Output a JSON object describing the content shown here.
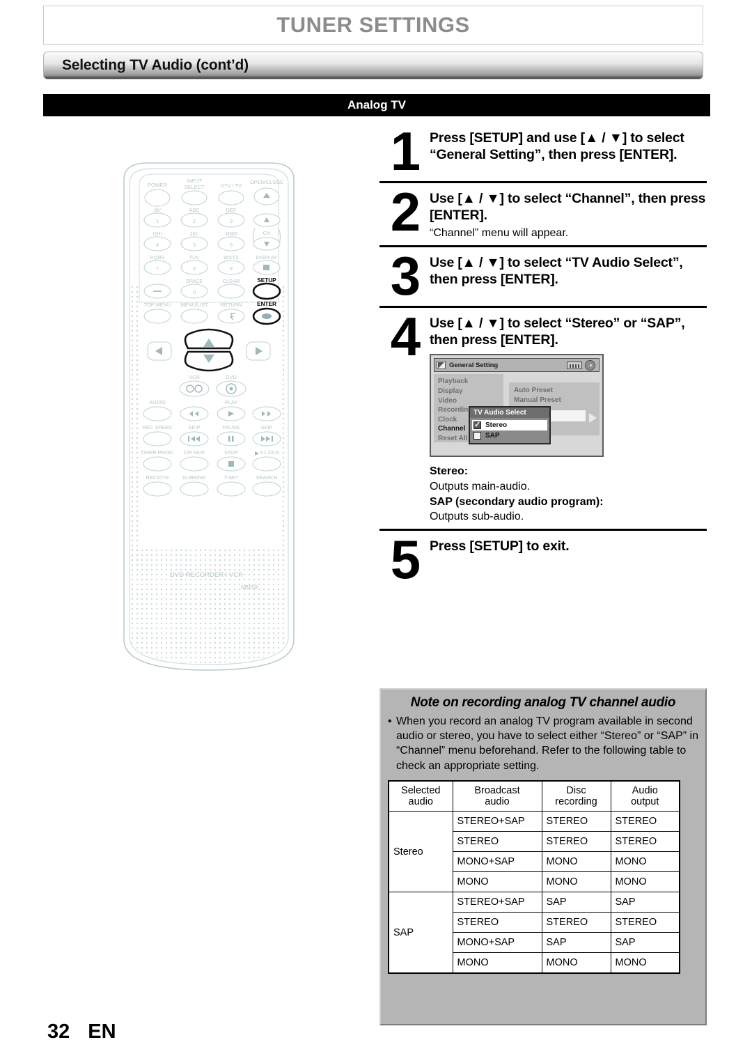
{
  "header": {
    "chapter_title": "TUNER SETTINGS",
    "section_title": "Selecting TV Audio (cont’d)",
    "subhead": "Analog TV"
  },
  "remote": {
    "brand": "DVD RECORDER / VCR",
    "model": "NB659",
    "buttons": [
      "POWER",
      "INPUT SELECT",
      "DTV / TV",
      "OPEN/CLOSE",
      ".@/:",
      "ABC",
      "DEF",
      "GHI",
      "JKL",
      "MNO",
      "CH",
      "PQRS",
      "TUV",
      "WXYZ",
      "DISPLAY",
      "SPACE",
      "CLEAR",
      "SETUP",
      "TOP MENU",
      "MENU/LIST",
      "RETURN",
      "ENTER",
      "VCR",
      "DVD",
      "AUDIO",
      "PLAY",
      "REC SPEED",
      "SKIP",
      "PAUSE",
      "SKIP",
      "TIMER PROG.",
      "CM SKIP",
      "STOP",
      "X1.3/0.8",
      "REC/OTR",
      "DUBBING",
      "T-SET",
      "SEARCH"
    ],
    "labels": {
      "power": "POWER",
      "input_select_l1": "INPUT",
      "input_select_l2": "SELECT",
      "dtv_tv": "DTV / TV",
      "open_close": "OPEN/CLOSE",
      "k1": ".@/:",
      "k2": "ABC",
      "k3": "DEF",
      "k4": "GHI",
      "k5": "JKL",
      "k6": "MNO",
      "k7": "PQRS",
      "k8": "TUV",
      "k9": "WXYZ",
      "ch": "CH",
      "display": "DISPLAY",
      "space": "SPACE",
      "clear": "CLEAR",
      "setup": "SETUP",
      "top_menu": "TOP MENU",
      "menu_list": "MENU/LIST",
      "return": "RETURN",
      "enter": "ENTER",
      "vcr": "VCR",
      "dvd": "DVD",
      "audio": "AUDIO",
      "play": "PLAY",
      "rec_speed": "REC SPEED",
      "skip_back": "SKIP",
      "pause": "PAUSE",
      "skip_fwd": "SKIP",
      "timer_prog": "TIMER PROG.",
      "cm_skip": "CM SKIP",
      "stop": "STOP",
      "speed": "X1.3/0.8",
      "rec_otr": "REC/OTR",
      "dubbing": "DUBBING",
      "t_set": "T-SET",
      "search": "SEARCH",
      "num1": "1",
      "num2": "2",
      "num3": "3",
      "num4": "4",
      "num5": "5",
      "num6": "6",
      "num7": "7",
      "num8": "8",
      "num9": "9",
      "num0": "0"
    }
  },
  "steps": [
    {
      "num": "1",
      "main": "Press [SETUP] and use [▲ / ▼] to select “General Setting”, then press [ENTER].",
      "sub": ""
    },
    {
      "num": "2",
      "main": "Use [▲ / ▼] to select “Channel”, then press [ENTER].",
      "sub": "“Channel” menu will appear."
    },
    {
      "num": "3",
      "main": "Use [▲ / ▼] to select “TV Audio Select”, then press [ENTER].",
      "sub": ""
    },
    {
      "num": "4",
      "main": "Use [▲ / ▼] to select “Stereo” or “SAP”, then press [ENTER].",
      "sub": ""
    },
    {
      "num": "5",
      "main": "Press [SETUP] to exit.",
      "sub": ""
    }
  ],
  "osd": {
    "title": "General Setting",
    "menu_items": [
      "Playback",
      "Display",
      "Video",
      "Recording",
      "Clock",
      "Channel",
      "Reset All"
    ],
    "selected_menu_item": "Channel",
    "right_items": [
      "Auto Preset",
      "Manual Preset"
    ],
    "popup_title": "TV Audio Select",
    "options": [
      {
        "label": "Stereo",
        "checked": true,
        "highlighted": true
      },
      {
        "label": "SAP",
        "checked": false,
        "highlighted": false
      }
    ]
  },
  "descriptions": {
    "stereo_term": "Stereo:",
    "stereo_text": "Outputs main-audio.",
    "sap_term": "SAP (secondary audio program):",
    "sap_text": "Outputs sub-audio."
  },
  "note": {
    "title": "Note on recording analog TV channel audio",
    "bullet": "When you record an analog TV program available in second audio or stereo, you have to select either “Stereo” or “SAP” in “Channel” menu beforehand. Refer to the following table to check an appropriate setting."
  },
  "table": {
    "headers": [
      {
        "l1": "Selected",
        "l2": "audio"
      },
      {
        "l1": "Broadcast",
        "l2": "audio"
      },
      {
        "l1": "Disc",
        "l2": "recording"
      },
      {
        "l1": "Audio",
        "l2": "output"
      }
    ],
    "groups": [
      {
        "selected": "Stereo",
        "rows": [
          {
            "broadcast": "STEREO+SAP",
            "disc": "STEREO",
            "output": "STEREO"
          },
          {
            "broadcast": "STEREO",
            "disc": "STEREO",
            "output": "STEREO"
          },
          {
            "broadcast": "MONO+SAP",
            "disc": "MONO",
            "output": "MONO"
          },
          {
            "broadcast": "MONO",
            "disc": "MONO",
            "output": "MONO"
          }
        ]
      },
      {
        "selected": "SAP",
        "rows": [
          {
            "broadcast": "STEREO+SAP",
            "disc": "SAP",
            "output": "SAP"
          },
          {
            "broadcast": "STEREO",
            "disc": "STEREO",
            "output": "STEREO"
          },
          {
            "broadcast": "MONO+SAP",
            "disc": "SAP",
            "output": "SAP"
          },
          {
            "broadcast": "MONO",
            "disc": "MONO",
            "output": "MONO"
          }
        ]
      }
    ]
  },
  "footer": {
    "page_number": "32",
    "language": "EN"
  }
}
